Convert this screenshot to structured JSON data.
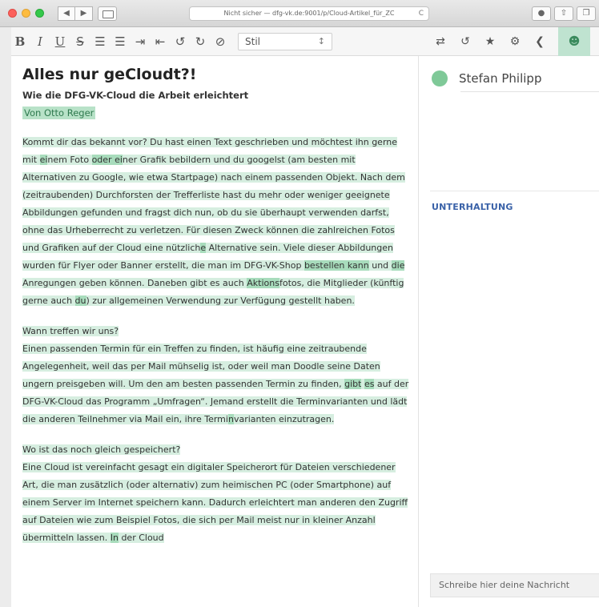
{
  "browser": {
    "url": "Nicht sicher — dfg-vk.de:9001/p/Cloud-Artikel_für_ZC",
    "back_label": "◀",
    "forward_label": "▶",
    "reload_label": "C"
  },
  "toolbar": {
    "bold": "B",
    "italic": "I",
    "underline": "U",
    "strike": "S",
    "style_value": "Stil"
  },
  "doc": {
    "title": "Alles nur geCloudt?!",
    "subtitle": "Wie die DFG-VK-Cloud die Arbeit erleichtert",
    "author": "Von Otto Reger",
    "paragraphs": [
      {
        "segments": [
          {
            "t": "Kommt dir das bekannt vor",
            "h": 1
          },
          {
            "t": "? Du hast einen Text geschrieben und möchtest ihn gerne mit ",
            "h": 1
          },
          {
            "t": "ei",
            "h": 2
          },
          {
            "t": "nem Foto ",
            "h": 1
          },
          {
            "t": "oder ei",
            "h": 2
          },
          {
            "t": "ner Grafik bebildern und du googelst (am besten mit Alternativen zu Google, wie etwa Startpage) nach einem passenden Objekt. Nach dem (zeitraubenden) Durchforsten der Trefferliste hast du mehr oder weniger geeignete Abbildungen gefunden und fragst dich nun, ob du sie überhaupt verwenden darfst, ohne das Urheberrecht zu verletzen. Für diesen Zweck können die zahlreichen Fotos und Grafiken auf der Cloud eine nützlich",
            "h": 1
          },
          {
            "t": "e",
            "h": 2
          },
          {
            "t": " Alternative sein. Viele dieser Abbildungen wurden für Flyer oder Banner erstellt, die man im DFG-VK-Shop ",
            "h": 1
          },
          {
            "t": "bestellen kann",
            "h": 2
          },
          {
            "t": " und ",
            "h": 1
          },
          {
            "t": "die",
            "h": 2
          },
          {
            "t": " Anregungen geben können. Daneben gibt es auch ",
            "h": 1
          },
          {
            "t": "Aktions",
            "h": 2
          },
          {
            "t": "fotos, die Mitglieder (künftig gerne auch ",
            "h": 1
          },
          {
            "t": "du",
            "h": 2
          },
          {
            "t": ") zur allgemeinen Verwendung zur Verfügung gestellt haben.",
            "h": 1
          }
        ]
      },
      {
        "segments": [
          {
            "t": "Wann treffen wir uns?",
            "h": 1,
            "br": true
          },
          {
            "t": "Einen passenden Termin für ein Treffen zu finden, ist häufig eine zeitraubende Angelegenheit, weil das per Mail mühselig ist, oder weil man Doodle seine Daten ungern preisgeben will. Um den am besten passenden Termin zu finden, ",
            "h": 1
          },
          {
            "t": "gibt",
            "h": 2
          },
          {
            "t": " ",
            "h": 1
          },
          {
            "t": "es",
            "h": 2
          },
          {
            "t": " auf der DFG-VK-Cloud das Programm „Umfragen“. Jemand erstellt die Terminvarianten und lädt die anderen Teilnehmer via Mail ein, ihre Termi",
            "h": 1
          },
          {
            "t": "n",
            "h": 2
          },
          {
            "t": "varianten einzutragen.",
            "h": 1
          }
        ]
      },
      {
        "segments": [
          {
            "t": "Wo ist das noch gleich gespeichert?",
            "h": 1,
            "br": true
          },
          {
            "t": "Eine Cloud ist vereinfacht gesagt ein digitaler Speicherort für Dateien verschiedener Art, die man zusätzlich (oder alternativ) zum heimischen PC (oder Smartphone) auf einem Server im Internet speichern kann. Dadurch erleichtert man anderen den Zugriff auf Dateien wie zum Beispiel Fotos, die sich per Mail meist nur in kleiner Anzahl übermitteln lassen. ",
            "h": 1
          },
          {
            "t": "In",
            "h": 2
          },
          {
            "t": " der Cloud",
            "h": 1
          }
        ]
      }
    ]
  },
  "panel": {
    "user_name": "Stefan Philipp",
    "section_title": "UNTERHALTUNG",
    "message_placeholder": "Schreibe hier deine Nachricht"
  }
}
